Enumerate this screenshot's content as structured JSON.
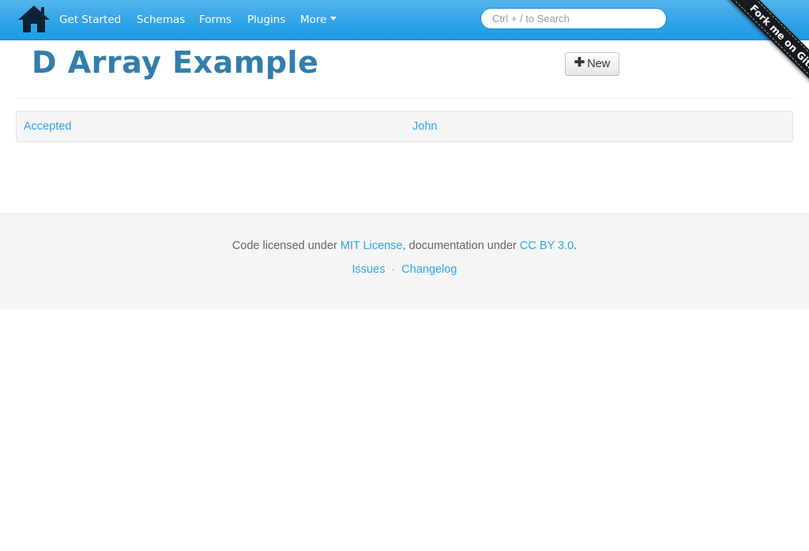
{
  "navbar": {
    "brand_icon": "home-icon",
    "items": [
      {
        "label": "Get Started"
      },
      {
        "label": "Schemas"
      },
      {
        "label": "Forms"
      },
      {
        "label": "Plugins"
      },
      {
        "label": "More"
      }
    ],
    "search_placeholder": "Ctrl + / to Search",
    "search_value": "",
    "accent_color": "#2fa4e7"
  },
  "ribbon": {
    "label": "Fork me on GitHub"
  },
  "page": {
    "title": "D Array Example",
    "new_button_label": "New",
    "new_button_icon": "plus-icon",
    "title_color": "#317eac"
  },
  "list": {
    "rows": [
      {
        "status": "Accepted",
        "name": "John"
      }
    ]
  },
  "footer": {
    "prefix": "Code licensed under ",
    "license_link": "MIT License",
    "middle": ", documentation under ",
    "docs_link": "CC BY 3.0",
    "suffix": ".",
    "issues_link": "Issues",
    "separator": "·",
    "changelog_link": "Changelog"
  }
}
